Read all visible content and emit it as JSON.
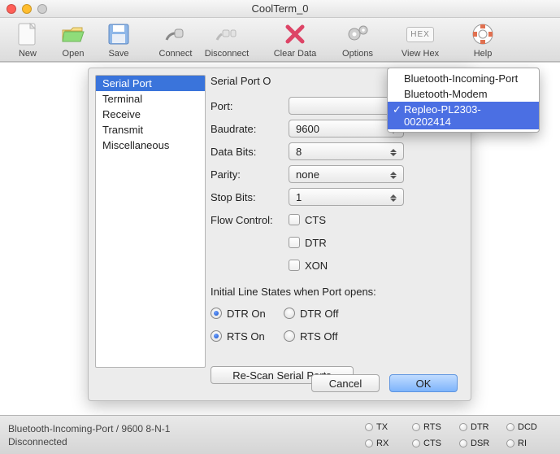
{
  "title": "CoolTerm_0",
  "toolbar": {
    "new": "New",
    "open": "Open",
    "save": "Save",
    "connect": "Connect",
    "disconnect": "Disconnect",
    "clear": "Clear Data",
    "options": "Options",
    "viewhex": "View Hex",
    "help": "Help",
    "hex_badge": "HEX"
  },
  "categories": [
    "Serial Port",
    "Terminal",
    "Receive",
    "Transmit",
    "Miscellaneous"
  ],
  "selected_category": "Serial Port",
  "panel": {
    "heading": "Serial Port O",
    "port_label": "Port:",
    "baud_label": "Baudrate:",
    "baud_value": "9600",
    "databits_label": "Data Bits:",
    "databits_value": "8",
    "parity_label": "Parity:",
    "parity_value": "none",
    "stopbits_label": "Stop Bits:",
    "stopbits_value": "1",
    "flow_label": "Flow Control:",
    "flow_cts": "CTS",
    "flow_dtr": "DTR",
    "flow_xon": "XON",
    "initial_heading": "Initial Line States when Port opens:",
    "dtr_on": "DTR On",
    "dtr_off": "DTR Off",
    "rts_on": "RTS On",
    "rts_off": "RTS Off",
    "rescan": "Re-Scan Serial Ports"
  },
  "dropdown": {
    "items": [
      "Bluetooth-Incoming-Port",
      "Bluetooth-Modem",
      "Repleo-PL2303-00202414"
    ],
    "selected": "Repleo-PL2303-00202414"
  },
  "buttons": {
    "cancel": "Cancel",
    "ok": "OK"
  },
  "status": {
    "line1": "Bluetooth-Incoming-Port / 9600 8-N-1",
    "line2": "Disconnected",
    "leds": [
      "TX",
      "RTS",
      "DTR",
      "DCD",
      "RX",
      "CTS",
      "DSR",
      "RI"
    ]
  }
}
